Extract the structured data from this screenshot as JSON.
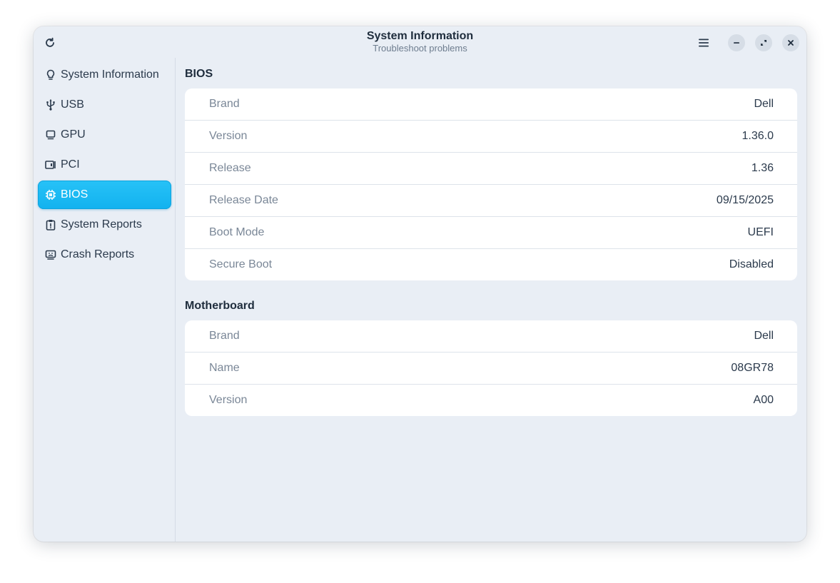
{
  "window": {
    "title": "System Information",
    "subtitle": "Troubleshoot problems"
  },
  "sidebar": {
    "items": [
      {
        "label": "System Information",
        "icon": "lightbulb-icon",
        "active": false
      },
      {
        "label": "USB",
        "icon": "usb-icon",
        "active": false
      },
      {
        "label": "GPU",
        "icon": "monitor-icon",
        "active": false
      },
      {
        "label": "PCI",
        "icon": "pci-card-icon",
        "active": false
      },
      {
        "label": "BIOS",
        "icon": "chip-icon",
        "active": true
      },
      {
        "label": "System Reports",
        "icon": "report-icon",
        "active": false
      },
      {
        "label": "Crash Reports",
        "icon": "crash-monitor-icon",
        "active": false
      }
    ]
  },
  "sections": [
    {
      "title": "BIOS",
      "rows": [
        {
          "key": "Brand",
          "value": "Dell"
        },
        {
          "key": "Version",
          "value": "1.36.0"
        },
        {
          "key": "Release",
          "value": "1.36"
        },
        {
          "key": "Release Date",
          "value": "09/15/2025"
        },
        {
          "key": "Boot Mode",
          "value": "UEFI"
        },
        {
          "key": "Secure Boot",
          "value": "Disabled"
        }
      ]
    },
    {
      "title": "Motherboard",
      "rows": [
        {
          "key": "Brand",
          "value": "Dell"
        },
        {
          "key": "Name",
          "value": "08GR78"
        },
        {
          "key": "Version",
          "value": "A00"
        }
      ]
    }
  ],
  "colors": {
    "accent": "#1cb8f3",
    "window_bg": "#e9eef5",
    "card_bg": "#ffffff"
  }
}
